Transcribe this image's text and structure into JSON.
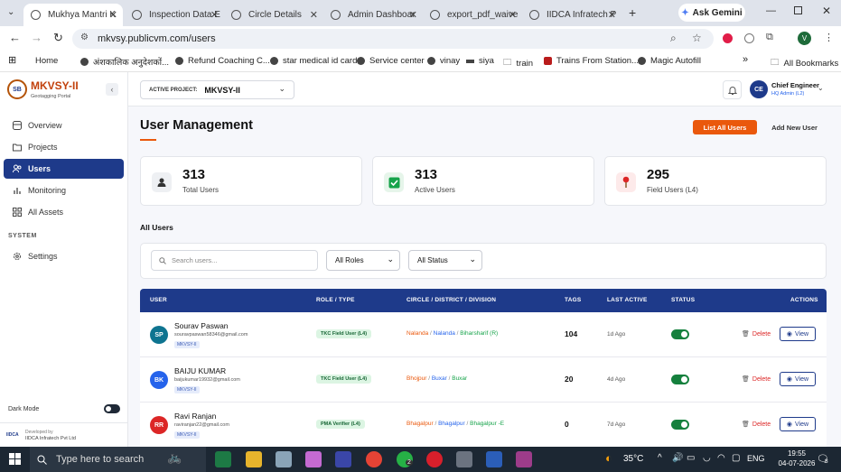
{
  "browser": {
    "tabs": [
      {
        "title": "Mukhya Mantri K",
        "active": true
      },
      {
        "title": "Inspection Data E"
      },
      {
        "title": "Circle Details"
      },
      {
        "title": "Admin Dashboar"
      },
      {
        "title": "export_pdf_waive"
      },
      {
        "title": "IIDCA Infratech P"
      }
    ],
    "ask_gemini": "Ask Gemini",
    "url": "mkvsy.publicvm.com/users",
    "profile_initial": "V",
    "bookmarks": [
      {
        "label": "Home"
      },
      {
        "label": "अंशकालिक अनुदेशकों..."
      },
      {
        "label": "Refund Coaching C..."
      },
      {
        "label": "star medical id card"
      },
      {
        "label": "Service center"
      },
      {
        "label": "vinay"
      },
      {
        "label": "siya"
      },
      {
        "label": "train"
      },
      {
        "label": "Trains From Station..."
      },
      {
        "label": "Magic Autofill"
      }
    ],
    "all_bookmarks": "All Bookmarks"
  },
  "app": {
    "logo_text": "MKVSY-II",
    "logo_sub": "Geotagging Portal",
    "logo_badge": "SB",
    "active_project_label": "ACTIVE PROJECT:",
    "active_project_value": "MKVSY-II",
    "user_initials": "CE",
    "user_name": "Chief Engineer",
    "user_role": "HQ Admin (L2)",
    "nav": [
      {
        "label": "Overview",
        "icon": "grid-icon"
      },
      {
        "label": "Projects",
        "icon": "folder-icon"
      },
      {
        "label": "Users",
        "icon": "users-icon",
        "active": true
      },
      {
        "label": "Monitoring",
        "icon": "bar-chart-icon"
      },
      {
        "label": "All Assets",
        "icon": "assets-icon"
      }
    ],
    "system_label": "SYSTEM",
    "settings_label": "Settings",
    "dark_mode_label": "Dark Mode",
    "developed_by": "Developed by",
    "developer": "IIDCA Infratech Pvt Ltd",
    "dev_logo": "IIDCA"
  },
  "page": {
    "title": "User Management",
    "list_all_button": "List All Users",
    "add_new_button": "Add New User",
    "stats": [
      {
        "value": "313",
        "label": "Total Users",
        "icon": "user-card-icon"
      },
      {
        "value": "313",
        "label": "Active Users",
        "icon": "check-icon"
      },
      {
        "value": "295",
        "label": "Field Users (L4)",
        "icon": "pin-icon"
      }
    ],
    "all_users_label": "All Users",
    "search_placeholder": "Search users...",
    "roles_filter": "All Roles",
    "status_filter": "All Status",
    "columns": [
      "USER",
      "ROLE / TYPE",
      "CIRCLE / DISTRICT / DIVISION",
      "TAGS",
      "LAST ACTIVE",
      "STATUS",
      "ACTIONS"
    ],
    "rows": [
      {
        "initials": "SP",
        "avatar_color": "#0e7490",
        "name": "Sourav Paswan",
        "email": "souravpaswan58346@gmail.com",
        "project": "MKVSY-II",
        "role": "TKC Field User (L4)",
        "circle": "Nalanda",
        "district": "Nalanda",
        "division": "Biharsharif (R)",
        "tags": "104",
        "last_active": "1d Ago"
      },
      {
        "initials": "BK",
        "avatar_color": "#2563eb",
        "name": "BAIJU KUMAR",
        "email": "baijukumar19932@gmail.com",
        "project": "MKVSY-II",
        "role": "TKC Field User (L4)",
        "circle": "Bhojpur",
        "district": "Buxar",
        "division": "Buxar",
        "tags": "20",
        "last_active": "4d Ago"
      },
      {
        "initials": "RR",
        "avatar_color": "#dc2626",
        "name": "Ravi Ranjan",
        "email": "raviranjan22@gmail.com",
        "project": "MKVSY-II",
        "role": "PMA Verifier (L4)",
        "circle": "Bhagalpur",
        "district": "Bhagalpur",
        "division": "Bhagalpur -E",
        "tags": "0",
        "last_active": "7d Ago"
      }
    ],
    "delete_label": "Delete",
    "view_label": "View"
  },
  "taskbar": {
    "search_text": "Type here to search",
    "temperature": "35°C",
    "lang": "ENG",
    "time": "19:55",
    "date": "04-07-2026",
    "notif_count": "8",
    "whatsapp_count": "2"
  }
}
